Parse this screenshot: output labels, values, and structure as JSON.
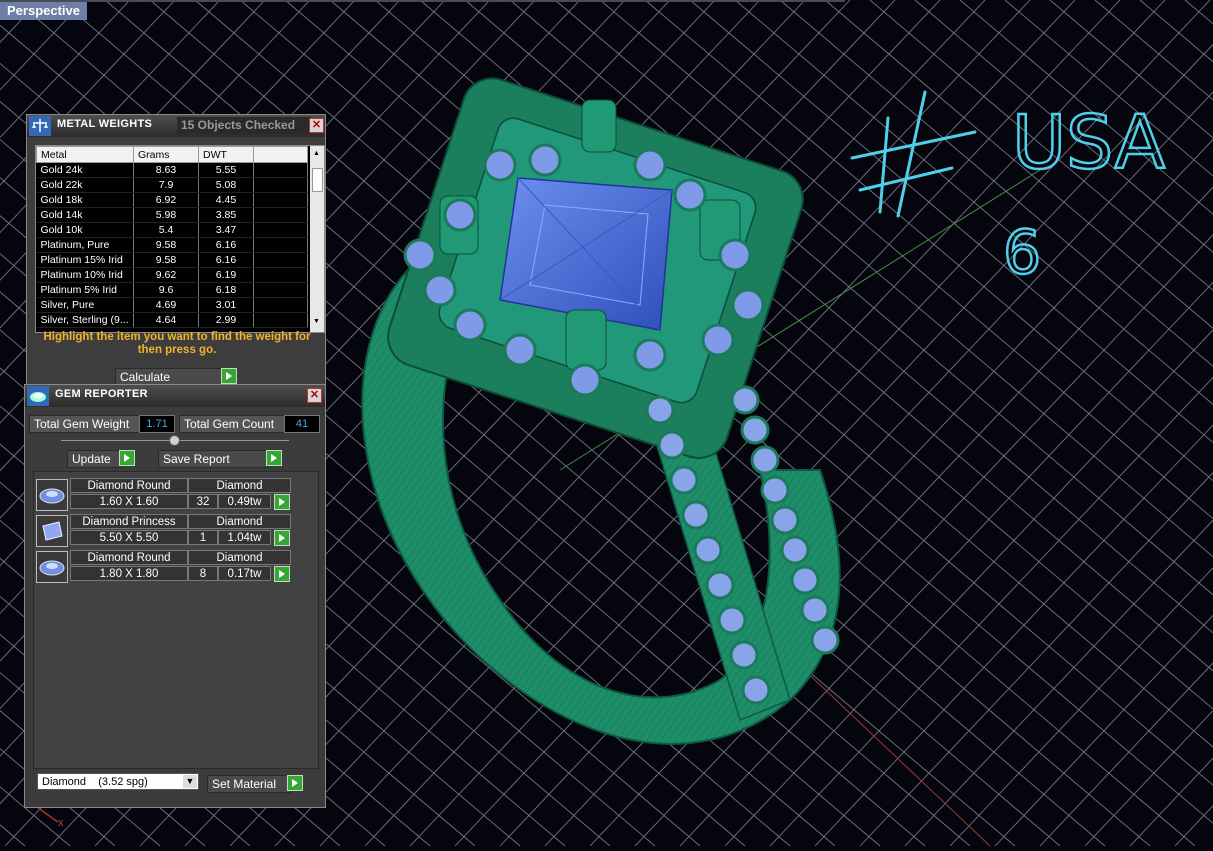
{
  "viewport": {
    "label": "Perspective",
    "annotation": {
      "symbol": "#",
      "line1": "USA",
      "line2": "6"
    },
    "axis_label": "x"
  },
  "metal_weights": {
    "title": "METAL WEIGHTS",
    "objects_checked": "15 Objects Checked",
    "columns": [
      "Metal",
      "Grams",
      "DWT"
    ],
    "rows": [
      [
        "Gold 24k",
        "8.63",
        "5.55"
      ],
      [
        "Gold 22k",
        "7.9",
        "5.08"
      ],
      [
        "Gold 18k",
        "6.92",
        "4.45"
      ],
      [
        "Gold 14k",
        "5.98",
        "3.85"
      ],
      [
        "Gold 10k",
        "5.4",
        "3.47"
      ],
      [
        "Platinum, Pure",
        "9.58",
        "6.16"
      ],
      [
        "Platinum 15% Irid",
        "9.58",
        "6.16"
      ],
      [
        "Platinum 10% Irid",
        "9.62",
        "6.19"
      ],
      [
        "Platinum 5% Irid",
        "9.6",
        "6.18"
      ],
      [
        "Silver, Pure",
        "4.69",
        "3.01"
      ],
      [
        "Silver, Sterling (9...",
        "4.64",
        "2.99"
      ]
    ],
    "hint": "Highlight the item you want to find the weight for then press go.",
    "calculate_label": "Calculate"
  },
  "gem_reporter": {
    "title": "GEM REPORTER",
    "total_weight_label": "Total Gem Weight",
    "total_weight_value": "1.71",
    "total_count_label": "Total Gem Count",
    "total_count_value": "41",
    "update_label": "Update",
    "save_report_label": "Save Report",
    "gems": [
      {
        "shape": "Diamond Round",
        "material": "Diamond",
        "size": "1.60 X 1.60",
        "count": "32",
        "weight": "0.49tw"
      },
      {
        "shape": "Diamond Princess",
        "material": "Diamond",
        "size": "5.50 X 5.50",
        "count": "1",
        "weight": "1.04tw"
      },
      {
        "shape": "Diamond Round",
        "material": "Diamond",
        "size": "1.80 X 1.80",
        "count": "8",
        "weight": "0.17tw"
      }
    ],
    "material_select": "Diamond    (3.52 spg)",
    "set_material_label": "Set Material"
  },
  "colors": {
    "ring": "#1f8f6a",
    "gem": "#5b7fe0",
    "grid": "#b8b8c8",
    "annotation": "#4fd0e8",
    "hint": "#f4b12b"
  }
}
